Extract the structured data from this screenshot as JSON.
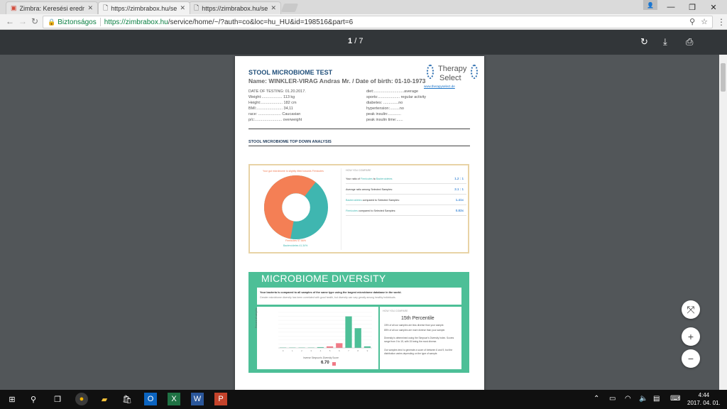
{
  "browser": {
    "tabs": [
      {
        "label": "Zimbra: Keresési eredmé",
        "favicon": "zimbra-icon"
      },
      {
        "label": "https://zimbrabox.hu/se",
        "favicon": "doc-icon"
      },
      {
        "label": "https://zimbrabox.hu/se",
        "favicon": "doc-icon"
      }
    ],
    "secure_label": "Biztonságos",
    "url_host": "https://zimbrabox.hu",
    "url_path": "/service/home/~/?auth=co&loc=hu_HU&id=198516&part=6"
  },
  "pdf": {
    "current_page": "1",
    "page_sep": "/",
    "total_pages": "7"
  },
  "document": {
    "title": "STOOL MICROBIOME TEST",
    "name_line": "Name: WINKLER-VIRAG Andras Mr. / Date of birth: 01-10-1973",
    "logo_line1": "Therapy",
    "logo_line2": "Select",
    "logo_link": "www.therapyselect.de",
    "left_info": [
      "DATE OF TESTING: 01.20.2017.",
      "Weight:................... 113 kg",
      "Height:.................... 182 cm",
      "BMI:........................ 34,11",
      "race: ..................... Caucasian",
      "p/c:......................... overweight"
    ],
    "right_info": [
      "diet:............................average",
      "sports:.................... regular activity",
      "diabetes: ..............no",
      "hypertension:.........no",
      "peak insulin:............",
      "peak insulin time:......"
    ],
    "section_heading": "STOOL MICROBIOME TOP DOWN ANALYSIS",
    "card1": {
      "caption": "Your gut microbiome is slightly tilted towards Firmicutes",
      "legend_firmicutes": "Firmicutes 57.66%",
      "legend_bacteroidetes": "Bacteroidetes 41.34%",
      "compare_heading": "HOW YOU COMPARE",
      "rows": [
        {
          "pre": "Your ratio of ",
          "a": "Firmicutes",
          "mid": " to ",
          "b": "Bacteroidetes",
          "value": "1.2 : 1"
        },
        {
          "pre": "Average ratio among Selected Samples:",
          "a": "",
          "mid": "",
          "b": "",
          "value": "2.1 : 1"
        },
        {
          "pre": "",
          "a": "Bacteroidetes",
          "mid": " compared to Selected Samples:",
          "b": "",
          "value": "1.41x"
        },
        {
          "pre": "",
          "a": "Firmicutes",
          "mid": " compared to Selected Samples:",
          "b": "",
          "value": "0.83x"
        }
      ]
    },
    "card2": {
      "title": "MICROBIOME DIVERSITY",
      "intro_bold": "Your bacteria is compared to all samples of the same type using the largest microbiome database in the world.",
      "intro_text": "Greater microbiome diversity has been correlated with good health, but diversity can vary greatly among healthy individuals.",
      "compare_heading": "HOW YOU COMPARE",
      "percentile": "15th Percentile",
      "p1": "15% of all our samples are less diverse than your sample.",
      "p2": "85% of all our samples are more diverse than your sample.",
      "p3": "Diversity is determined using the Simpson's Diversity Index. Scores range from 0 to 15, with 15 being the most diverse.",
      "p4": "Our samples tend to generate a score of between 6 and 9, but the distribution varies depending on the type of sample.",
      "y_axis_label": "Percent of samples",
      "x_axis_label": "Inverse Simpson's Diversity Score",
      "score": "6.70"
    }
  },
  "chart_data": {
    "type": "bar",
    "title": "",
    "xlabel": "Inverse Simpson's Diversity Score",
    "ylabel": "Percent of samples",
    "categories": [
      "0",
      "1",
      "2",
      "3",
      "4",
      "5",
      "6",
      "7",
      "8",
      "9"
    ],
    "values": [
      0.5,
      0.5,
      0.5,
      0.5,
      1,
      2,
      6,
      40,
      25,
      2
    ],
    "highlight_categories": [
      "5",
      "6"
    ],
    "ylim": [
      0,
      45
    ],
    "colors": {
      "bar": "#4dbf97",
      "highlight": "#f07a86"
    }
  },
  "colors": {
    "firmicutes": "#f47f55",
    "bacteroidetes": "#3fb6b0",
    "diversity_bg": "#4dbf97",
    "doc_title": "#1f4e79"
  },
  "taskbar": {
    "time": "4:44",
    "date": "2017. 04. 01."
  }
}
